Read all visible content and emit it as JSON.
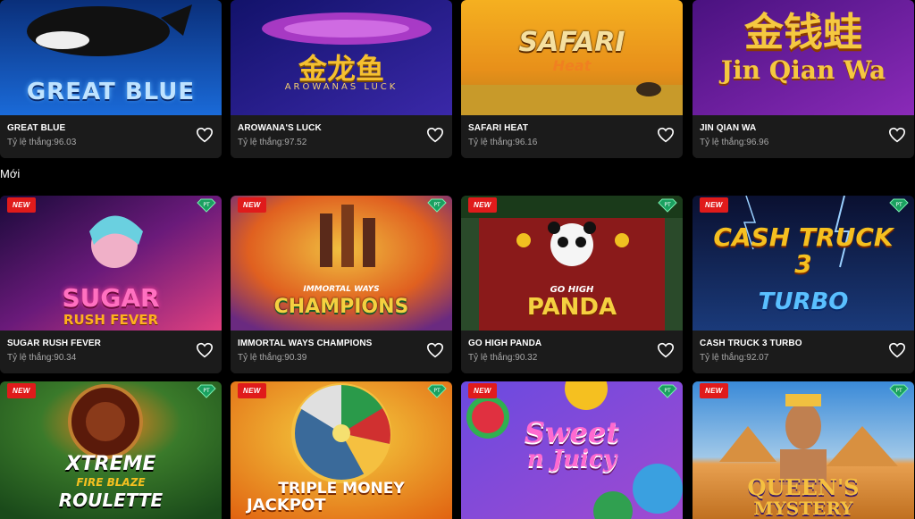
{
  "section": {
    "title": "Mới"
  },
  "rate_prefix": "Tỷ lệ thắng:",
  "top_row": [
    {
      "name": "GREAT BLUE",
      "rate": "Tỷ lệ thắng:96.03",
      "art_text": "GREAT BLUE",
      "colors": [
        "#0a3d91",
        "#1566d6"
      ]
    },
    {
      "name": "AROWANA'S LUCK",
      "rate": "Tỷ lệ thắng:97.52",
      "art_text": "金龙鱼",
      "art_sub": "AROWANAS LUCK",
      "colors": [
        "#1a1a7a",
        "#3a2ca8"
      ]
    },
    {
      "name": "SAFARI HEAT",
      "rate": "Tỷ lệ thắng:96.16",
      "art_text": "SAFARI",
      "art_sub": "Heat",
      "colors": [
        "#f0a020",
        "#c46a10"
      ]
    },
    {
      "name": "JIN QIAN WA",
      "rate": "Tỷ lệ thắng:96.96",
      "art_text": "金钱蛙",
      "art_sub": "Jin Qian Wa",
      "colors": [
        "#5a1a8a",
        "#8a2ab0"
      ]
    }
  ],
  "new_row": [
    {
      "name": "SUGAR RUSH FEVER",
      "rate": "Tỷ lệ thắng:90.34",
      "art_text": "SUGAR",
      "art_sub": "RUSH FEVER",
      "badge": "NEW",
      "colors": [
        "#2a0a4a",
        "#c03070"
      ]
    },
    {
      "name": "IMMORTAL WAYS CHAMPIONS",
      "rate": "Tỷ lệ thắng:90.39",
      "art_text": "CHAMPIONS",
      "art_sub": "IMMORTAL WAYS",
      "badge": "NEW",
      "colors": [
        "#c04010",
        "#e0a020"
      ]
    },
    {
      "name": "GO HIGH PANDA",
      "rate": "Tỷ lệ thắng:90.32",
      "art_text": "PANDA",
      "art_sub": "GO HIGH",
      "badge": "NEW",
      "colors": [
        "#1a4a1a",
        "#8a1a1a"
      ]
    },
    {
      "name": "CASH TRUCK 3 TURBO",
      "rate": "Tỷ lệ thắng:92.07",
      "art_text": "CASH TRUCK 3",
      "art_sub": "TURBO",
      "badge": "NEW",
      "colors": [
        "#0a1a3a",
        "#1a3a7a"
      ]
    }
  ],
  "bottom_row": [
    {
      "art_text": "XTREME",
      "art_sub": "FIRE BLAZE",
      "art_sub2": "ROULETTE",
      "badge": "NEW",
      "colors": [
        "#1a5a1a",
        "#3a8a2a"
      ]
    },
    {
      "art_text": "TRIPLE MONEY",
      "art_sub": "JACKPOT",
      "badge": "NEW",
      "colors": [
        "#e07010",
        "#f0b020"
      ]
    },
    {
      "art_text": "Sweet",
      "art_sub": "n Juicy",
      "badge": "NEW",
      "colors": [
        "#5a3ad0",
        "#9a4ae0"
      ]
    },
    {
      "art_text": "QUEEN'S",
      "art_sub": "MYSTERY",
      "badge": "NEW",
      "colors": [
        "#3a8ad0",
        "#e0a060"
      ]
    }
  ],
  "icons": {
    "heart": "heart-icon",
    "pt": "pt-diamond-icon"
  }
}
